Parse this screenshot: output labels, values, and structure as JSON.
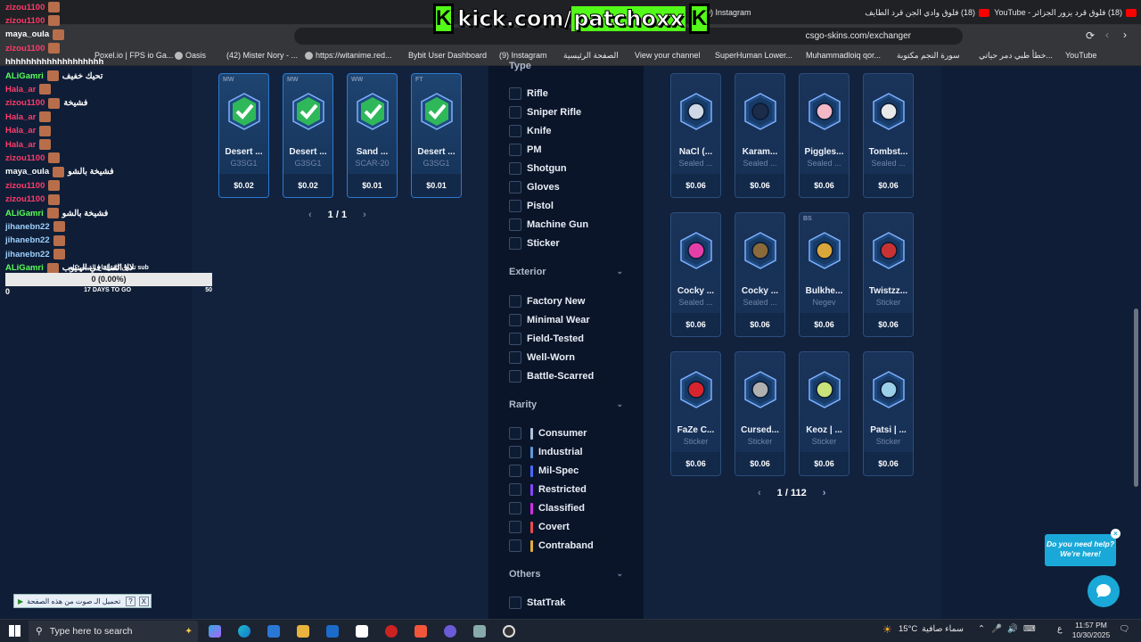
{
  "browser": {
    "tabs": [
      {
        "label": "(9) Instagram",
        "icon": "instagram-icon"
      },
      {
        "label": "(18) فلوق وادي الجن قرد الطايف",
        "icon": "youtube-icon"
      },
      {
        "label": "(18) فلوق قرد يزور الجزائر - YouTube",
        "icon": "youtube-icon"
      }
    ],
    "url": "csgo-skins.com/exchanger",
    "bookmarks": [
      "Poxel.io | FPS io Ga...",
      "Oasis",
      "(42) Mister Nory - ...",
      "https://witanime.red...",
      "Bybit User Dashboard",
      "(9) Instagram",
      "الصفحة الرئيسية",
      "View your channel",
      "SuperHuman Lower...",
      "Muhammadloiq qor...",
      "سورة النجم مكتوبة",
      "خطأ طبي دمر حياتي...",
      "YouTube"
    ]
  },
  "overlay": {
    "kick_prefix": "kick.com/",
    "kick_channel": "patchoxx",
    "chat": [
      {
        "user": "zizou1100",
        "text": "",
        "color": "#ff3b6b"
      },
      {
        "user": "zizou1100",
        "text": "",
        "color": "#ff3b6b"
      },
      {
        "user": "maya_oula",
        "text": "",
        "color": "#ffffff"
      },
      {
        "user": "zizou1100",
        "text": "",
        "color": "#ff3b6b"
      },
      {
        "user": "",
        "text": "hhhhhhhhhhhhhhhhhhh",
        "color": "#ffffff"
      },
      {
        "user": "ALiGamri",
        "text": "تحيك خفيف",
        "color": "#58ff58"
      },
      {
        "user": "Hala_ar",
        "text": "",
        "color": "#ff3b6b"
      },
      {
        "user": "zizou1100",
        "text": "فشيخة",
        "color": "#ff3b6b"
      },
      {
        "user": "Hala_ar",
        "text": "",
        "color": "#ff3b6b"
      },
      {
        "user": "Hala_ar",
        "text": "",
        "color": "#ff3b6b"
      },
      {
        "user": "Hala_ar",
        "text": "",
        "color": "#ff3b6b"
      },
      {
        "user": "zizou1100",
        "text": "",
        "color": "#ff3b6b"
      },
      {
        "user": "maya_oula",
        "text": "فشيخة بالشو",
        "color": "#ffffff"
      },
      {
        "user": "zizou1100",
        "text": "",
        "color": "#ff3b6b"
      },
      {
        "user": "zizou1100",
        "text": "",
        "color": "#ff3b6b"
      },
      {
        "user": "ALiGamri",
        "text": "فشيخة بالشو",
        "color": "#58ff58"
      },
      {
        "user": "jihanebn22",
        "text": "",
        "color": "#9fd0ff"
      },
      {
        "user": "jihanebn22",
        "text": "",
        "color": "#9fd0ff"
      },
      {
        "user": "jihanebn22",
        "text": "",
        "color": "#9fd0ff"
      },
      {
        "user": "ALiGamri",
        "text": "لالا القتلة في اليتيوب",
        "color": "#58ff58"
      }
    ],
    "sub_goal": {
      "title": "تحرق كامرا تاع القيس كام sub",
      "bar_text": "0 (0.00%)",
      "progress": 0,
      "min": "0",
      "days": "17 DAYS TO GO",
      "max": "50"
    },
    "sound_notice": "تحميل الـ صوت من هذه الصفحة"
  },
  "inventory": {
    "cards": [
      {
        "wear": "MW",
        "name": "Desert ...",
        "sub": "G3SG1",
        "price": "$0.02"
      },
      {
        "wear": "MW",
        "name": "Desert ...",
        "sub": "G3SG1",
        "price": "$0.02"
      },
      {
        "wear": "WW",
        "name": "Sand ...",
        "sub": "SCAR-20",
        "price": "$0.01"
      },
      {
        "wear": "FT",
        "name": "Desert ...",
        "sub": "G3SG1",
        "price": "$0.01"
      }
    ],
    "pager": "1 / 1"
  },
  "filters": {
    "type_header": "Type",
    "types": [
      "Rifle",
      "Sniper Rifle",
      "Knife",
      "PM",
      "Shotgun",
      "Gloves",
      "Pistol",
      "Machine Gun",
      "Sticker"
    ],
    "exterior_header": "Exterior",
    "exteriors": [
      "Factory New",
      "Minimal Wear",
      "Field-Tested",
      "Well-Worn",
      "Battle-Scarred"
    ],
    "rarity_header": "Rarity",
    "rarities": [
      {
        "label": "Consumer",
        "color": "#b0c3d9"
      },
      {
        "label": "Industrial",
        "color": "#5e98d9"
      },
      {
        "label": "Mil-Spec",
        "color": "#4b69ff"
      },
      {
        "label": "Restricted",
        "color": "#8847ff"
      },
      {
        "label": "Classified",
        "color": "#d32ce6"
      },
      {
        "label": "Covert",
        "color": "#eb4b4b"
      },
      {
        "label": "Contraband",
        "color": "#e4ae39"
      }
    ],
    "others_header": "Others",
    "others": [
      "StatTrak"
    ]
  },
  "shop": {
    "cards": [
      {
        "wear": "",
        "name": "NaCl (...",
        "sub": "Sealed ...",
        "price": "$0.06",
        "icon": "graffiti-icon"
      },
      {
        "wear": "",
        "name": "Karam...",
        "sub": "Sealed ...",
        "price": "$0.06",
        "icon": "graffiti-icon"
      },
      {
        "wear": "",
        "name": "Piggles...",
        "sub": "Sealed ...",
        "price": "$0.06",
        "icon": "graffiti-icon"
      },
      {
        "wear": "",
        "name": "Tombst...",
        "sub": "Sealed ...",
        "price": "$0.06",
        "icon": "graffiti-icon"
      },
      {
        "wear": "",
        "name": "Cocky ...",
        "sub": "Sealed ...",
        "price": "$0.06",
        "icon": "graffiti-icon"
      },
      {
        "wear": "",
        "name": "Cocky ...",
        "sub": "Sealed ...",
        "price": "$0.06",
        "icon": "graffiti-icon"
      },
      {
        "wear": "BS",
        "name": "Bulkhe...",
        "sub": "Negev",
        "price": "$0.06",
        "icon": "rifle-icon"
      },
      {
        "wear": "",
        "name": "Twistzz...",
        "sub": "Sticker",
        "price": "$0.06",
        "icon": "sticker-icon"
      },
      {
        "wear": "",
        "name": "FaZe C...",
        "sub": "Sticker",
        "price": "$0.06",
        "icon": "sticker-icon"
      },
      {
        "wear": "",
        "name": "Cursed...",
        "sub": "Sticker",
        "price": "$0.06",
        "icon": "sticker-icon"
      },
      {
        "wear": "",
        "name": "Keoz | ...",
        "sub": "Sticker",
        "price": "$0.06",
        "icon": "sticker-icon"
      },
      {
        "wear": "",
        "name": "Patsi | ...",
        "sub": "Sticker",
        "price": "$0.06",
        "icon": "sticker-icon"
      }
    ],
    "pager": "1 / 112"
  },
  "help": {
    "line1": "Do you need help?",
    "line2": "We're here!"
  },
  "taskbar": {
    "search_placeholder": "Type here to search",
    "weather": "15°C",
    "weather_text": "سماء صافية",
    "time": "11:57 PM",
    "date": "10/30/2025",
    "lang": "ع"
  }
}
